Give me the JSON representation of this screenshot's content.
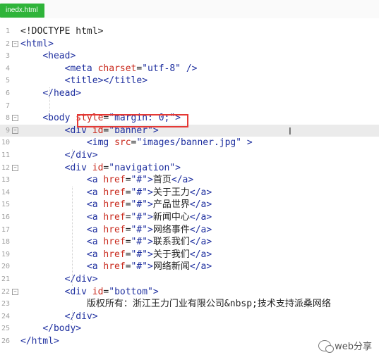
{
  "tab": {
    "label": "inedx.html"
  },
  "editor": {
    "highlighted_text": "style=\"margin: 0;\"",
    "current_line": 9,
    "lines": [
      {
        "n": "1",
        "fold": "",
        "tokens": [
          {
            "t": "<!DOCTYPE html>",
            "c": "txt"
          }
        ]
      },
      {
        "n": "2",
        "fold": "⊟",
        "tokens": [
          {
            "t": "<html>",
            "c": "tag"
          }
        ]
      },
      {
        "n": "3",
        "fold": "",
        "tokens": [
          {
            "t": "    "
          },
          {
            "t": "<head>",
            "c": "tag"
          }
        ]
      },
      {
        "n": "4",
        "fold": "",
        "tokens": [
          {
            "t": "        "
          },
          {
            "t": "<meta ",
            "c": "tag"
          },
          {
            "t": "charset",
            "c": "attr"
          },
          {
            "t": "=",
            "c": "txt"
          },
          {
            "t": "\"utf-8\"",
            "c": "val"
          },
          {
            "t": " />",
            "c": "tag"
          }
        ]
      },
      {
        "n": "5",
        "fold": "",
        "tokens": [
          {
            "t": "        "
          },
          {
            "t": "<title></title>",
            "c": "tag"
          }
        ]
      },
      {
        "n": "6",
        "fold": "",
        "tokens": [
          {
            "t": "    "
          },
          {
            "t": "</head>",
            "c": "tag"
          }
        ]
      },
      {
        "n": "7",
        "fold": "",
        "tokens": []
      },
      {
        "n": "8",
        "fold": "⊟",
        "tokens": [
          {
            "t": "    "
          },
          {
            "t": "<body ",
            "c": "tag"
          },
          {
            "t": "style",
            "c": "attr"
          },
          {
            "t": "=",
            "c": "txt"
          },
          {
            "t": "\"margin: 0;\"",
            "c": "val"
          },
          {
            "t": ">",
            "c": "tag"
          }
        ]
      },
      {
        "n": "9",
        "fold": "⊟",
        "tokens": [
          {
            "t": "        "
          },
          {
            "t": "<div ",
            "c": "tag"
          },
          {
            "t": "id",
            "c": "attr"
          },
          {
            "t": "=",
            "c": "txt"
          },
          {
            "t": "\"banner\"",
            "c": "val"
          },
          {
            "t": ">",
            "c": "tag"
          }
        ]
      },
      {
        "n": "10",
        "fold": "",
        "tokens": [
          {
            "t": "            "
          },
          {
            "t": "<img ",
            "c": "tag"
          },
          {
            "t": "src",
            "c": "attr"
          },
          {
            "t": "=",
            "c": "txt"
          },
          {
            "t": "\"images/banner.jpg\"",
            "c": "val"
          },
          {
            "t": " >",
            "c": "tag"
          }
        ]
      },
      {
        "n": "11",
        "fold": "",
        "tokens": [
          {
            "t": "        "
          },
          {
            "t": "</div>",
            "c": "tag"
          }
        ]
      },
      {
        "n": "12",
        "fold": "⊟",
        "tokens": [
          {
            "t": "        "
          },
          {
            "t": "<div ",
            "c": "tag"
          },
          {
            "t": "id",
            "c": "attr"
          },
          {
            "t": "=",
            "c": "txt"
          },
          {
            "t": "\"navigation\"",
            "c": "val"
          },
          {
            "t": ">",
            "c": "tag"
          }
        ]
      },
      {
        "n": "13",
        "fold": "",
        "tokens": [
          {
            "t": "            "
          },
          {
            "t": "<a ",
            "c": "tag"
          },
          {
            "t": "href",
            "c": "attr"
          },
          {
            "t": "=",
            "c": "txt"
          },
          {
            "t": "\"#\"",
            "c": "val"
          },
          {
            "t": ">",
            "c": "tag"
          },
          {
            "t": "首页",
            "c": "txt"
          },
          {
            "t": "</a>",
            "c": "tag"
          }
        ]
      },
      {
        "n": "14",
        "fold": "",
        "tokens": [
          {
            "t": "            "
          },
          {
            "t": "<a ",
            "c": "tag"
          },
          {
            "t": "href",
            "c": "attr"
          },
          {
            "t": "=",
            "c": "txt"
          },
          {
            "t": "\"#\"",
            "c": "val"
          },
          {
            "t": ">",
            "c": "tag"
          },
          {
            "t": "关于王力",
            "c": "txt"
          },
          {
            "t": "</a>",
            "c": "tag"
          }
        ]
      },
      {
        "n": "15",
        "fold": "",
        "tokens": [
          {
            "t": "            "
          },
          {
            "t": "<a ",
            "c": "tag"
          },
          {
            "t": "href",
            "c": "attr"
          },
          {
            "t": "=",
            "c": "txt"
          },
          {
            "t": "\"#\"",
            "c": "val"
          },
          {
            "t": ">",
            "c": "tag"
          },
          {
            "t": "产品世界",
            "c": "txt"
          },
          {
            "t": "</a>",
            "c": "tag"
          }
        ]
      },
      {
        "n": "16",
        "fold": "",
        "tokens": [
          {
            "t": "            "
          },
          {
            "t": "<a ",
            "c": "tag"
          },
          {
            "t": "href",
            "c": "attr"
          },
          {
            "t": "=",
            "c": "txt"
          },
          {
            "t": "\"#\"",
            "c": "val"
          },
          {
            "t": ">",
            "c": "tag"
          },
          {
            "t": "新闻中心",
            "c": "txt"
          },
          {
            "t": "</a>",
            "c": "tag"
          }
        ]
      },
      {
        "n": "17",
        "fold": "",
        "tokens": [
          {
            "t": "            "
          },
          {
            "t": "<a ",
            "c": "tag"
          },
          {
            "t": "href",
            "c": "attr"
          },
          {
            "t": "=",
            "c": "txt"
          },
          {
            "t": "\"#\"",
            "c": "val"
          },
          {
            "t": ">",
            "c": "tag"
          },
          {
            "t": "网络事件",
            "c": "txt"
          },
          {
            "t": "</a>",
            "c": "tag"
          }
        ]
      },
      {
        "n": "18",
        "fold": "",
        "tokens": [
          {
            "t": "            "
          },
          {
            "t": "<a ",
            "c": "tag"
          },
          {
            "t": "href",
            "c": "attr"
          },
          {
            "t": "=",
            "c": "txt"
          },
          {
            "t": "\"#\"",
            "c": "val"
          },
          {
            "t": ">",
            "c": "tag"
          },
          {
            "t": "联系我们",
            "c": "txt"
          },
          {
            "t": "</a>",
            "c": "tag"
          }
        ]
      },
      {
        "n": "19",
        "fold": "",
        "tokens": [
          {
            "t": "            "
          },
          {
            "t": "<a ",
            "c": "tag"
          },
          {
            "t": "href",
            "c": "attr"
          },
          {
            "t": "=",
            "c": "txt"
          },
          {
            "t": "\"#\"",
            "c": "val"
          },
          {
            "t": ">",
            "c": "tag"
          },
          {
            "t": "关于我们",
            "c": "txt"
          },
          {
            "t": "</a>",
            "c": "tag"
          }
        ]
      },
      {
        "n": "20",
        "fold": "",
        "tokens": [
          {
            "t": "            "
          },
          {
            "t": "<a ",
            "c": "tag"
          },
          {
            "t": "href",
            "c": "attr"
          },
          {
            "t": "=",
            "c": "txt"
          },
          {
            "t": "\"#\"",
            "c": "val"
          },
          {
            "t": ">",
            "c": "tag"
          },
          {
            "t": "网络新闻",
            "c": "txt"
          },
          {
            "t": "</a>",
            "c": "tag"
          }
        ]
      },
      {
        "n": "21",
        "fold": "",
        "tokens": [
          {
            "t": "        "
          },
          {
            "t": "</div>",
            "c": "tag"
          }
        ]
      },
      {
        "n": "22",
        "fold": "⊟",
        "tokens": [
          {
            "t": "        "
          },
          {
            "t": "<div ",
            "c": "tag"
          },
          {
            "t": "id",
            "c": "attr"
          },
          {
            "t": "=",
            "c": "txt"
          },
          {
            "t": "\"bottom\"",
            "c": "val"
          },
          {
            "t": ">",
            "c": "tag"
          }
        ]
      },
      {
        "n": "23",
        "fold": "",
        "tokens": [
          {
            "t": "            "
          },
          {
            "t": "版权所有：浙江王力门业有限公司&nbsp;技术支持派桑网络",
            "c": "txt"
          }
        ]
      },
      {
        "n": "24",
        "fold": "",
        "tokens": [
          {
            "t": "        "
          },
          {
            "t": "</div>",
            "c": "tag"
          }
        ]
      },
      {
        "n": "25",
        "fold": "",
        "tokens": [
          {
            "t": "    "
          },
          {
            "t": "</body>",
            "c": "tag"
          }
        ]
      },
      {
        "n": "26",
        "fold": "",
        "tokens": [
          {
            "t": "</html>",
            "c": "tag"
          }
        ]
      }
    ]
  },
  "watermark": {
    "text": "web分享"
  },
  "colors": {
    "tab_bg": "#2fb43a",
    "tag": "#1e2f9f",
    "attribute": "#c8271a",
    "highlight_box": "#e53935"
  }
}
